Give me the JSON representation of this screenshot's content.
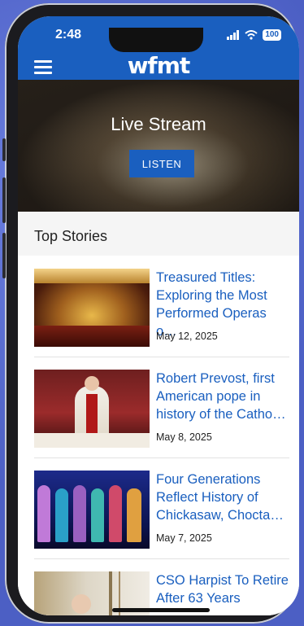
{
  "status": {
    "time": "2:48",
    "battery": "100"
  },
  "header": {
    "logo": "wfmt"
  },
  "hero": {
    "title": "Live Stream",
    "button": "LISTEN"
  },
  "section": {
    "title": "Top Stories"
  },
  "stories": [
    {
      "title": "Treasured Titles: Exploring the Most Performed Operas o…",
      "date": "May 12, 2025"
    },
    {
      "title": "Robert Prevost, first American pope in history of the Catho…",
      "date": "May 8, 2025"
    },
    {
      "title": "Four Generations Reflect History of Chickasaw, Chocta…",
      "date": "May 7, 2025"
    },
    {
      "title": "CSO Harpist To Retire After 63 Years",
      "date": ""
    }
  ],
  "colors": {
    "accent": "#1a5fbf"
  },
  "icons": [
    "menu-icon",
    "signal-icon",
    "wifi-icon",
    "battery-icon"
  ]
}
